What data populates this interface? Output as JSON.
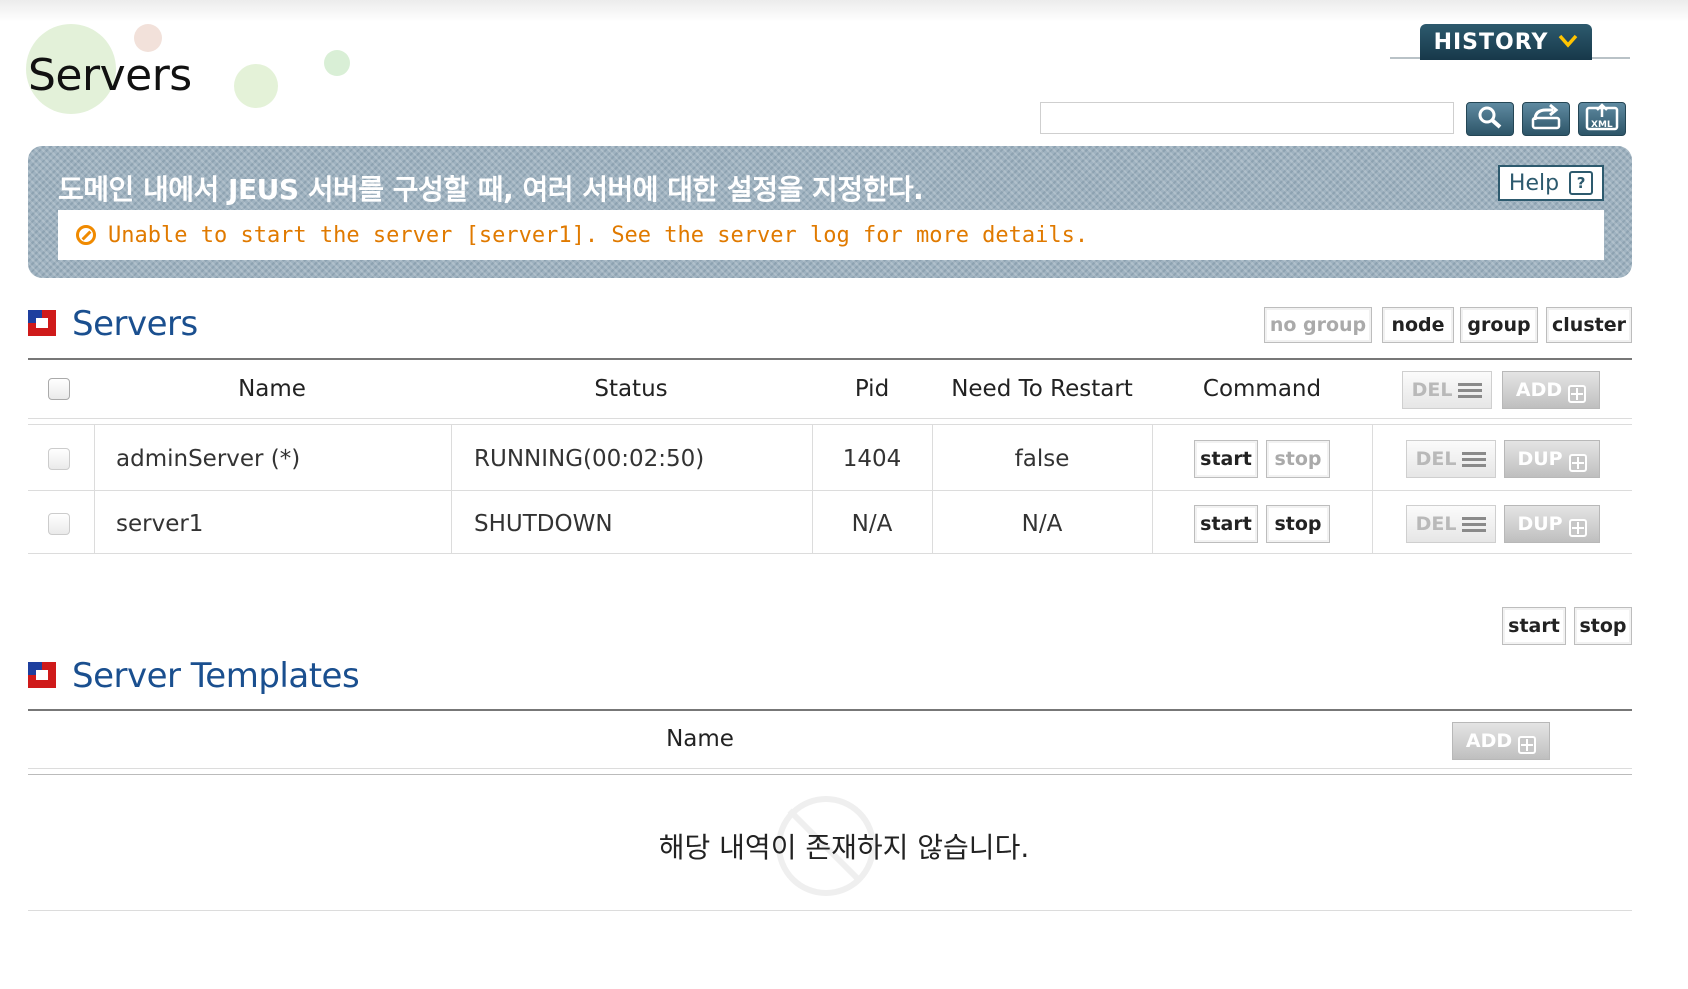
{
  "page": {
    "title": "Servers"
  },
  "history": {
    "label": "HISTORY"
  },
  "search": {
    "value": ""
  },
  "toolbar": {
    "icons": [
      "search-icon",
      "refresh-icon",
      "xml-export-icon"
    ]
  },
  "info": {
    "title": "도메인 내에서 JEUS 서버를 구성할 때, 여러 서버에 대한 설정을 지정한다.",
    "help_label": "Help",
    "help_icon": "?",
    "error_message": "Unable to start the server [server1]. See the server log for more details."
  },
  "servers": {
    "title": "Servers",
    "filters": [
      "no group",
      "node",
      "group",
      "cluster"
    ],
    "columns": {
      "name": "Name",
      "status": "Status",
      "pid": "Pid",
      "need_restart": "Need To Restart",
      "command": "Command"
    },
    "header_buttons": {
      "del": "DEL",
      "add": "ADD"
    },
    "rows": [
      {
        "name": "adminServer (*)",
        "status": "RUNNING(00:02:50)",
        "pid": "1404",
        "need_restart": "false",
        "start": "start",
        "stop": "stop",
        "del": "DEL",
        "dup": "DUP"
      },
      {
        "name": "server1",
        "status": "SHUTDOWN",
        "pid": "N/A",
        "need_restart": "N/A",
        "start": "start",
        "stop": "stop",
        "del": "DEL",
        "dup": "DUP"
      }
    ],
    "bulk": {
      "start": "start",
      "stop": "stop"
    }
  },
  "templates": {
    "title": "Server Templates",
    "columns": {
      "name": "Name"
    },
    "add_label": "ADD",
    "empty_message": "해당 내역이 존재하지 않습니다."
  },
  "colors": {
    "accent": "#1a4f8f",
    "header_bar": "#2d5a6e",
    "warning": "#e07a00",
    "info_box": "#9fb2c0"
  }
}
